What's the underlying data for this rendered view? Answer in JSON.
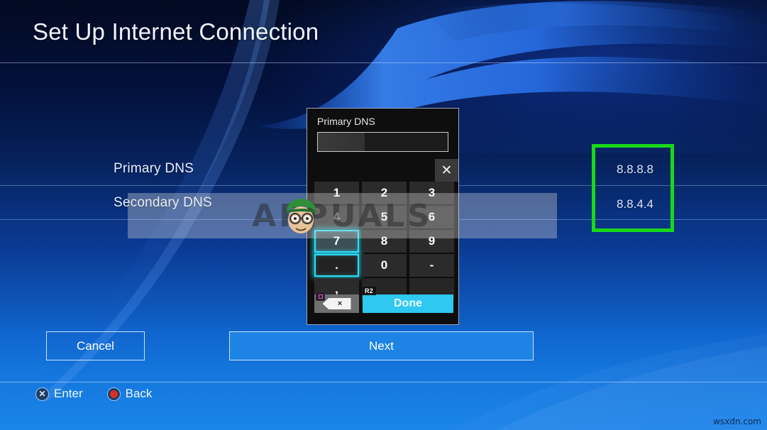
{
  "page": {
    "title": "Set Up Internet Connection",
    "site_watermark": "wsxdn.com",
    "overlay_watermark": "APPUALS"
  },
  "fields": [
    {
      "label": "Primary DNS",
      "value": "8.8.8.8"
    },
    {
      "label": "Secondary DNS",
      "value": "8.8.4.4"
    }
  ],
  "highlight": {
    "color": "#18d818",
    "note": "green-box-around-dns-values"
  },
  "keypad": {
    "title": "Primary DNS",
    "input_value": "",
    "close_label": "✕",
    "keys": [
      {
        "label": "1",
        "state": "normal"
      },
      {
        "label": "2",
        "state": "normal"
      },
      {
        "label": "3",
        "state": "normal"
      },
      {
        "label": "4",
        "state": "normal"
      },
      {
        "label": "5",
        "state": "normal"
      },
      {
        "label": "6",
        "state": "normal"
      },
      {
        "label": "7",
        "state": "selected"
      },
      {
        "label": "8",
        "state": "normal"
      },
      {
        "label": "9",
        "state": "normal"
      },
      {
        "label": ".",
        "state": "selected"
      },
      {
        "label": "0",
        "state": "normal"
      },
      {
        "label": "-",
        "state": "normal"
      },
      {
        "label": ",",
        "state": "normal"
      },
      {
        "label": "",
        "state": "blank"
      },
      {
        "label": "",
        "state": "blank"
      }
    ],
    "backspace": {
      "badge": "square-button",
      "label": "×"
    },
    "done": {
      "label": "Done",
      "badge": "R2"
    },
    "accent_color": "#2ec8f0",
    "selection_color": "#2ddcf5"
  },
  "footer": {
    "cancel_label": "Cancel",
    "next_label": "Next",
    "accent_color": "#1d83e4"
  },
  "hints": [
    {
      "button": "cross",
      "glyph": "✕",
      "label": "Enter"
    },
    {
      "button": "circle",
      "glyph": "●",
      "label": "Back"
    }
  ]
}
